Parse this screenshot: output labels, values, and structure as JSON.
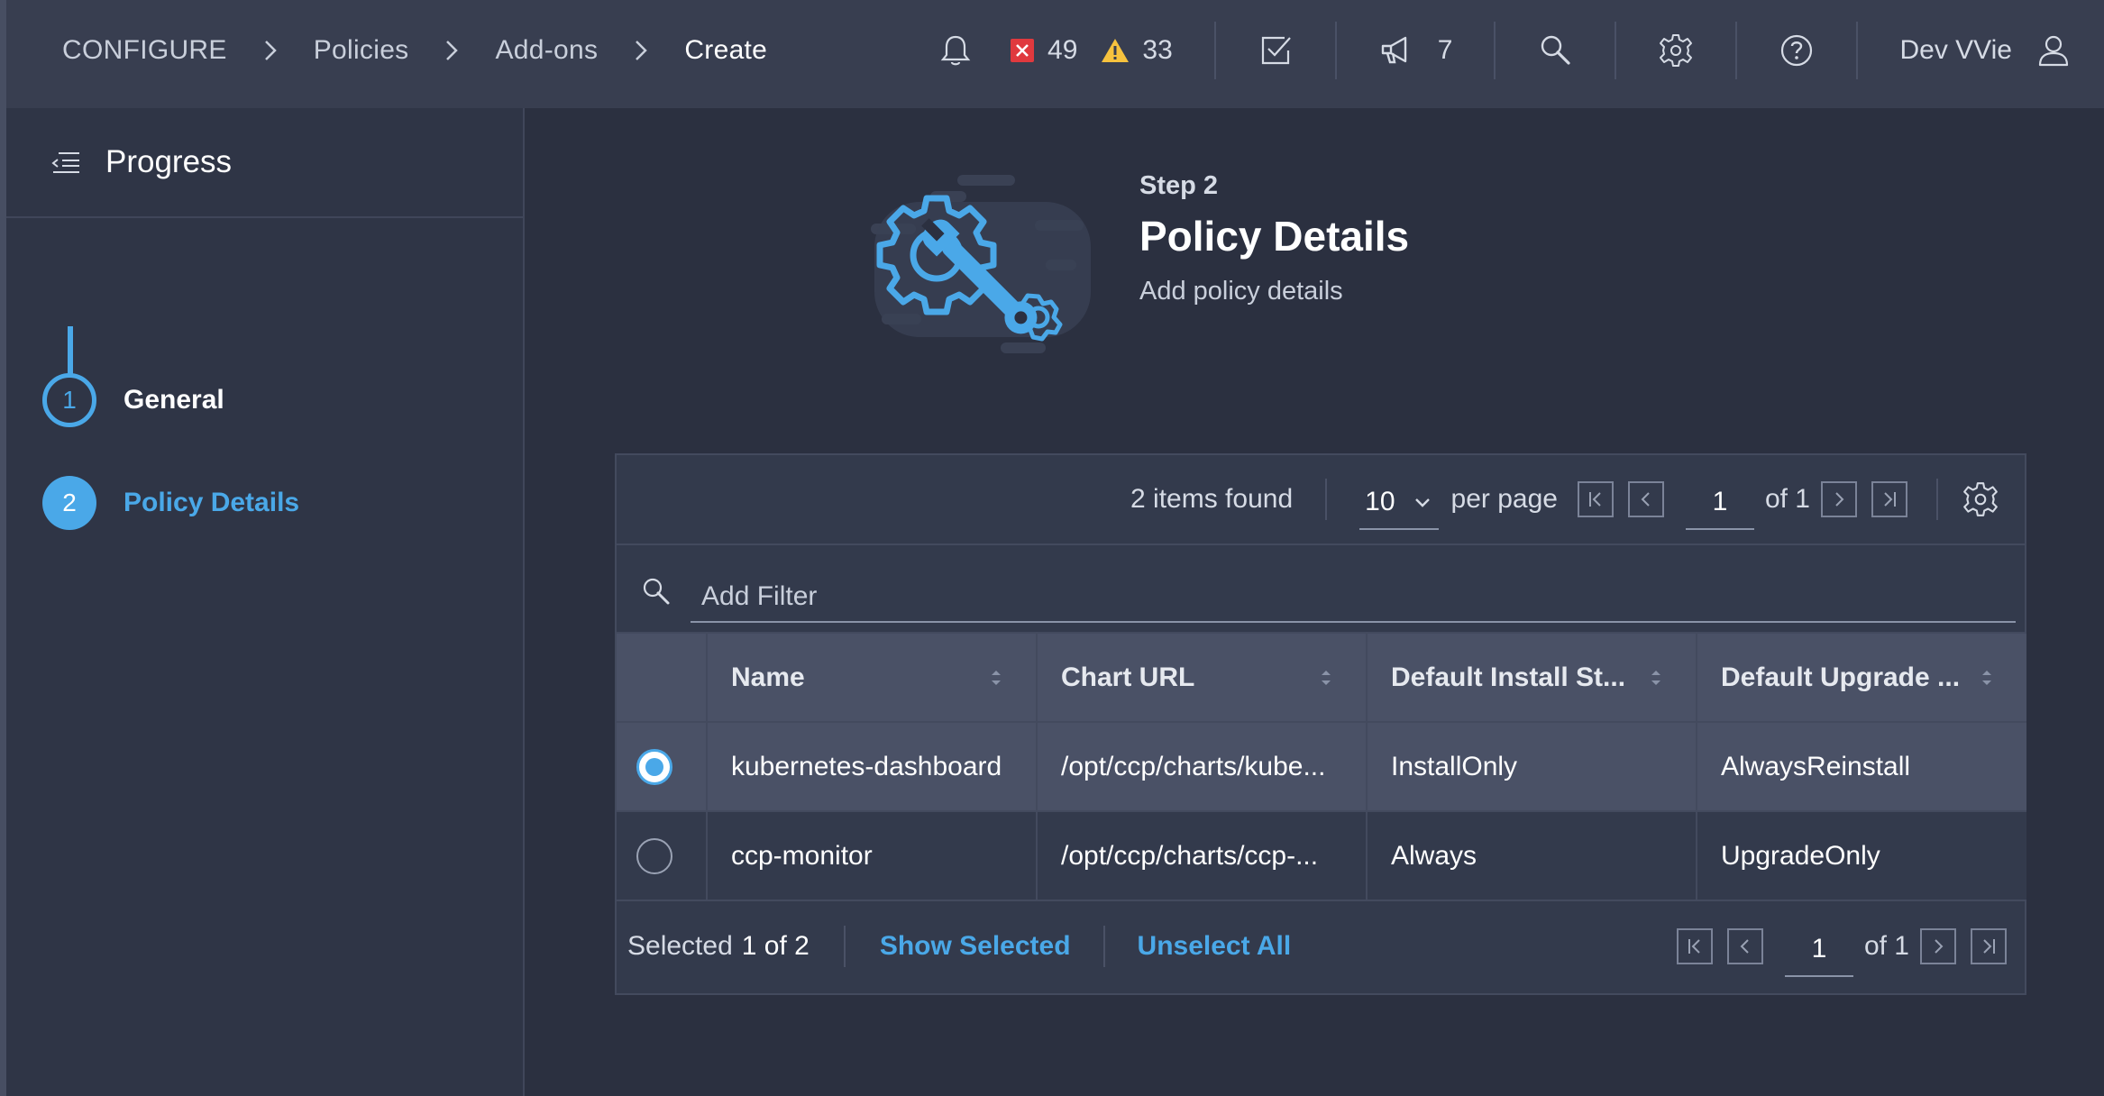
{
  "breadcrumb": [
    "CONFIGURE",
    "Policies",
    "Add-ons",
    "Create"
  ],
  "header": {
    "error_count": "49",
    "warning_count": "33",
    "announcement_count": "7",
    "user_name": "Dev VVie",
    "error_color": "#e0393e",
    "warning_color": "#f6c23e"
  },
  "sidebar": {
    "title": "Progress",
    "steps": [
      {
        "number": "1",
        "label": "General",
        "state": "done"
      },
      {
        "number": "2",
        "label": "Policy Details",
        "state": "active"
      }
    ]
  },
  "hero": {
    "step": "Step 2",
    "title": "Policy Details",
    "description": "Add policy details"
  },
  "grid": {
    "items_found": "2 items found",
    "per_page_value": "10",
    "per_page_label": "per page",
    "page": "1",
    "of_pages": "of 1",
    "filter_placeholder": "Add Filter",
    "columns": [
      "Name",
      "Chart URL",
      "Default Install St...",
      "Default Upgrade ..."
    ],
    "rows": [
      {
        "selected": true,
        "name": "kubernetes-dashboard",
        "chart_url": "/opt/ccp/charts/kube...",
        "install": "InstallOnly",
        "upgrade": "AlwaysReinstall"
      },
      {
        "selected": false,
        "name": "ccp-monitor",
        "chart_url": "/opt/ccp/charts/ccp-...",
        "install": "Always",
        "upgrade": "UpgradeOnly"
      }
    ],
    "footer": {
      "selected_label": "Selected",
      "selected_value": "1 of 2",
      "show_selected": "Show Selected",
      "unselect_all": "Unselect All",
      "page": "1",
      "of_pages": "of 1"
    }
  },
  "colors": {
    "accent": "#4aa8e8",
    "topbar": "#383e50",
    "background": "#2b3040"
  },
  "icons": [
    "chevron-right-icon",
    "bell-icon",
    "error-icon",
    "warning-icon",
    "task-check-icon",
    "megaphone-icon",
    "search-icon",
    "gear-icon",
    "help-icon",
    "user-icon",
    "collapse-menu-icon",
    "settings-tools-illustration",
    "first-page-icon",
    "prev-page-icon",
    "next-page-icon",
    "last-page-icon",
    "sort-icon",
    "chevron-down-icon"
  ]
}
